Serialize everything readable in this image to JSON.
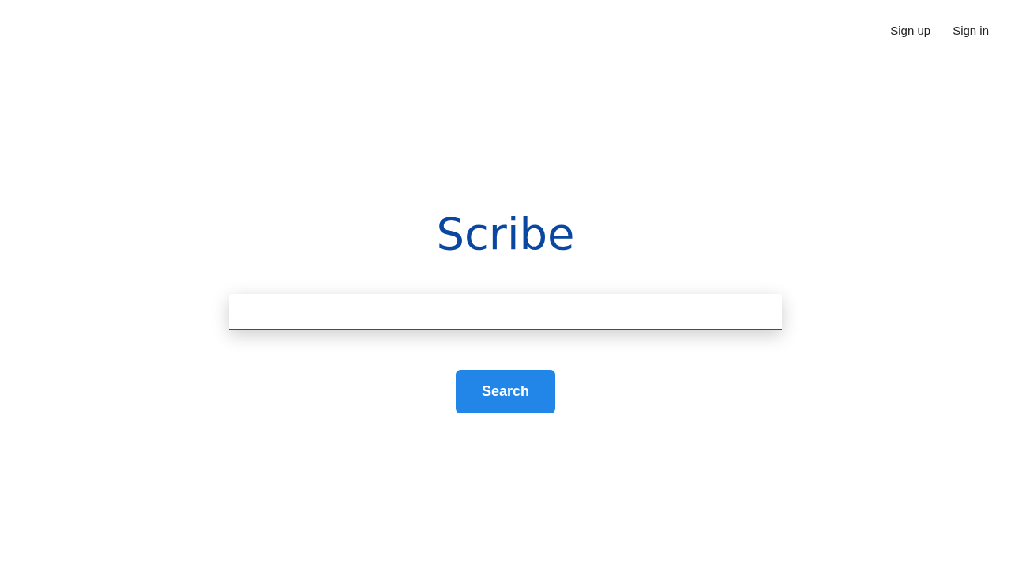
{
  "header": {
    "links": [
      "Sign up",
      "Sign in"
    ]
  },
  "logo": "Scribe",
  "search_field": {
    "focused": true
  },
  "search_button": "Search"
}
